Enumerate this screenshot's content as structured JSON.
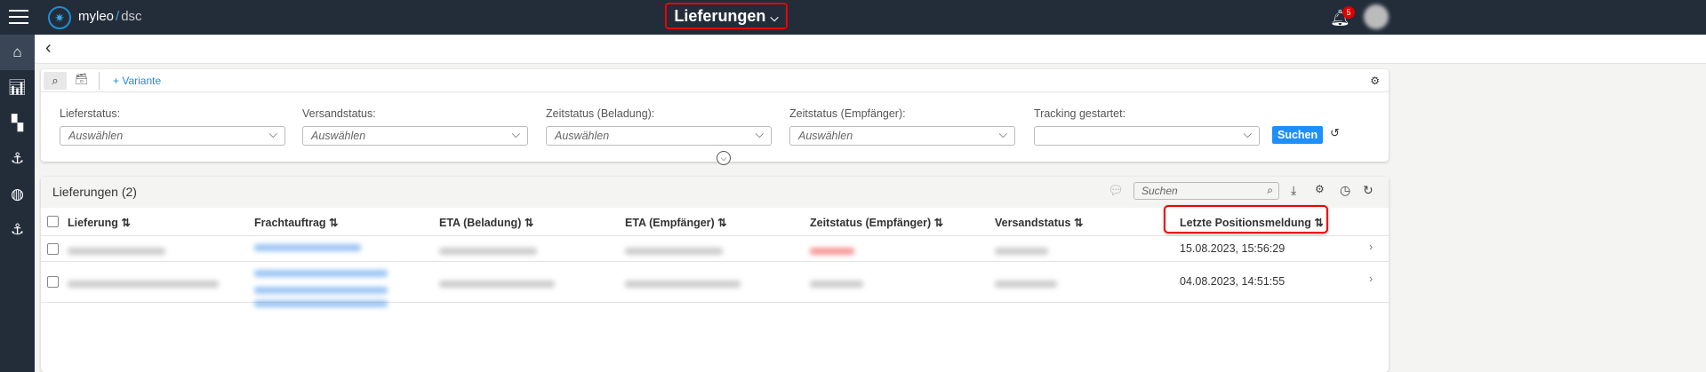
{
  "header": {
    "brand_a": "myleo",
    "brand_sep": "/",
    "brand_b": "dsc",
    "title": "Lieferungen",
    "notifications": "5"
  },
  "filter": {
    "variant": "+ Variante",
    "fields": [
      {
        "label": "Lieferstatus:",
        "value": "Auswählen"
      },
      {
        "label": "Versandstatus:",
        "value": "Auswählen"
      },
      {
        "label": "Zeitstatus (Beladung):",
        "value": "Auswählen"
      },
      {
        "label": "Zeitstatus (Empfänger):",
        "value": "Auswählen"
      },
      {
        "label": "Tracking gestartet:",
        "value": ""
      }
    ],
    "search_button": "Suchen"
  },
  "table": {
    "title": "Lieferungen (2)",
    "search_placeholder": "Suchen",
    "columns": [
      "Lieferung",
      "Frachtauftrag",
      "ETA (Beladung)",
      "ETA (Empfänger)",
      "Zeitstatus (Empfänger)",
      "Versandstatus",
      "Letzte Positionsmeldung"
    ],
    "rows": [
      {
        "last_position": "15.08.2023, 15:56:29"
      },
      {
        "last_position": "04.08.2023, 14:51:55"
      }
    ]
  }
}
